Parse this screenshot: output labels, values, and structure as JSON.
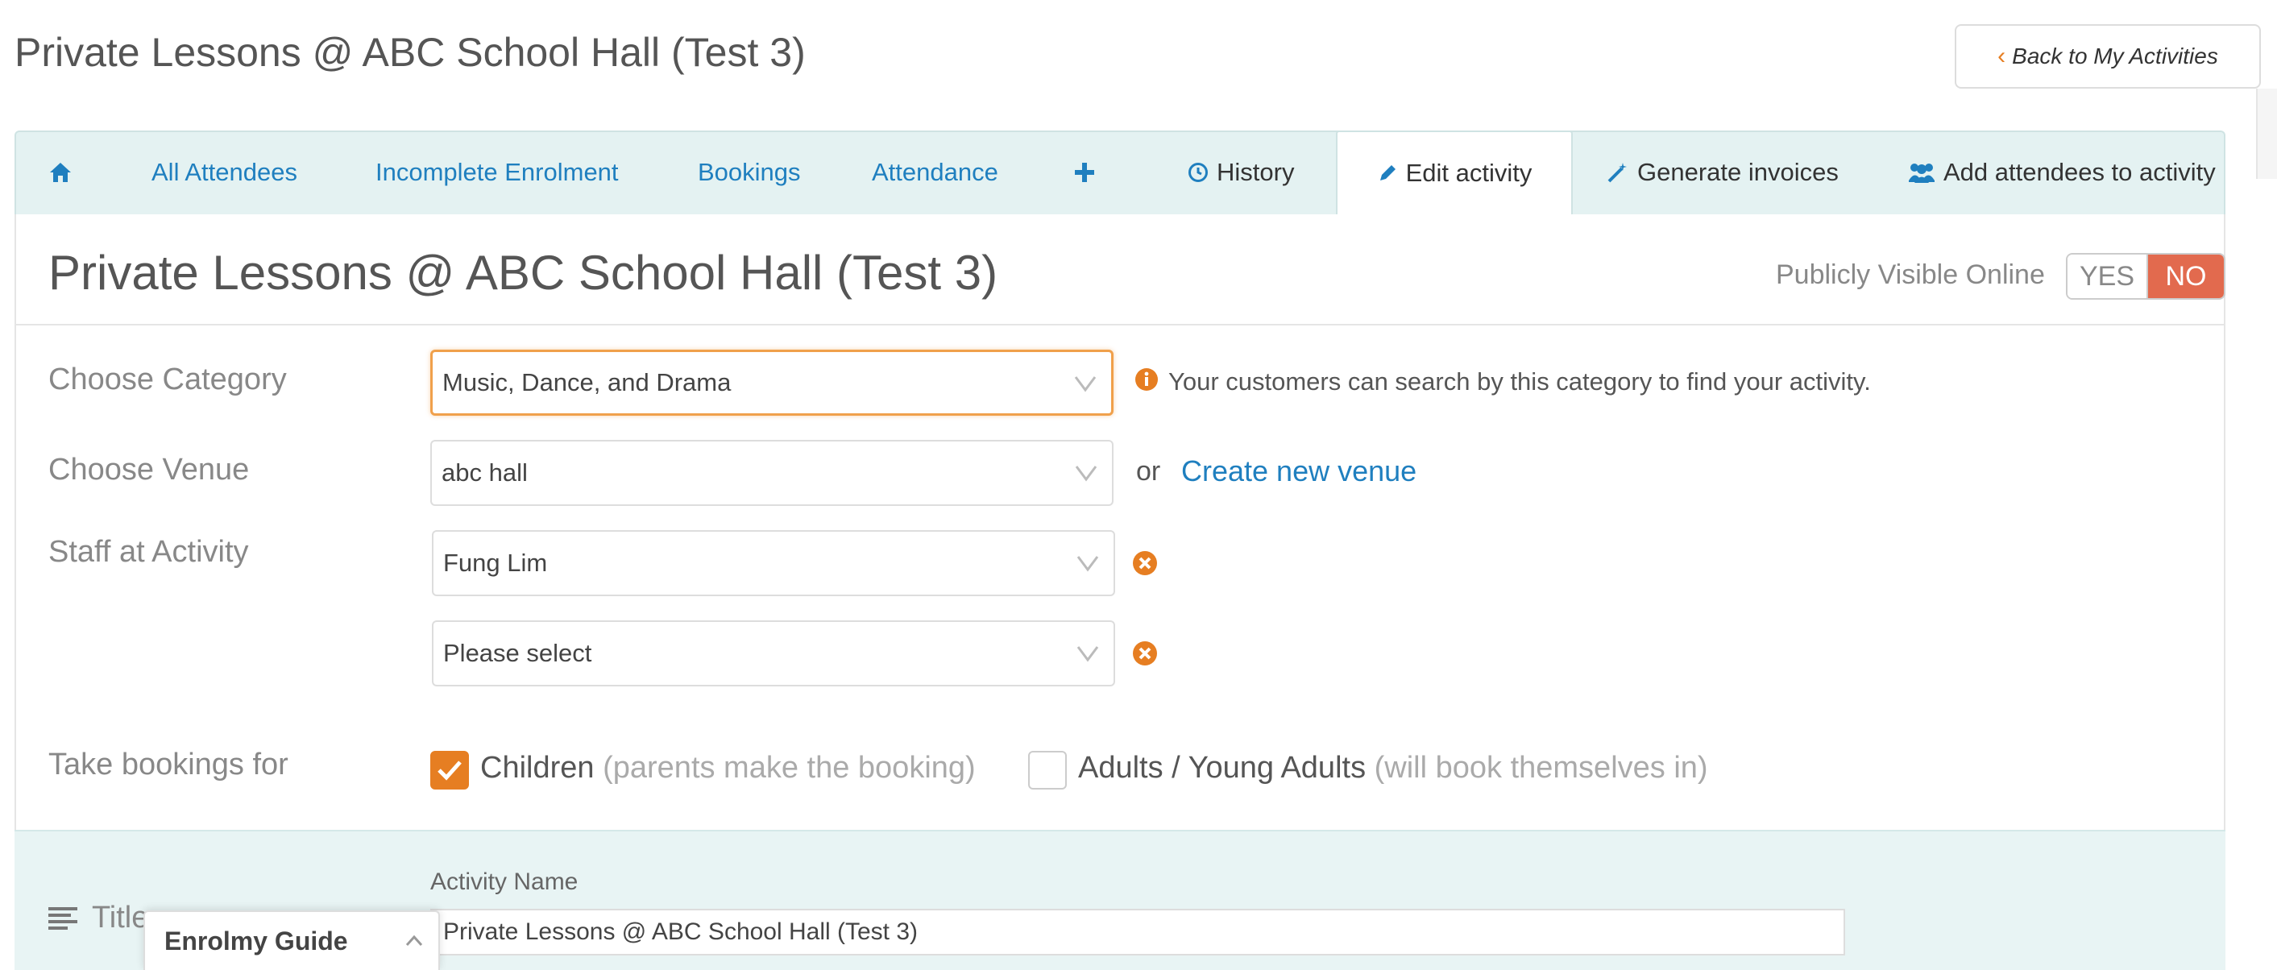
{
  "header": {
    "title": "Private Lessons @ ABC School Hall (Test 3)",
    "back_label": "Back to My Activities"
  },
  "tabs": {
    "home_icon": "home-icon",
    "all_attendees": "All Attendees",
    "incomplete": "Incomplete Enrolment",
    "bookings": "Bookings",
    "attendance": "Attendance",
    "plus_icon": "plus-icon",
    "history": "History",
    "edit": "Edit activity",
    "invoices": "Generate invoices",
    "add_attendees": "Add attendees to activity"
  },
  "activity": {
    "heading": "Private Lessons @ ABC School Hall (Test 3)",
    "visibility_label": "Publicly Visible Online",
    "yes": "YES",
    "no": "NO",
    "selected_visibility": "NO"
  },
  "form": {
    "category_label": "Choose Category",
    "category_value": "Music, Dance, and Drama",
    "category_hint": "Your customers can search by this category to find your activity.",
    "venue_label": "Choose Venue",
    "venue_value": "abc hall",
    "venue_or": "or",
    "create_venue": "Create new venue",
    "staff_label": "Staff at Activity",
    "staff": [
      "Fung Lim",
      "Please select"
    ],
    "bookings_label": "Take bookings for",
    "children_label": "Children",
    "children_sub": "(parents make the booking)",
    "children_checked": true,
    "adults_label": "Adults / Young Adults",
    "adults_sub": "(will book themselves in)",
    "adults_checked": false
  },
  "title_section": {
    "label": "Title",
    "name_label": "Activity Name",
    "name_value": "Private Lessons @ ABC School Hall (Test 3)"
  },
  "guide": {
    "label": "Enrolmy Guide"
  },
  "colors": {
    "accent": "#e67e22",
    "link": "#1f7fbf",
    "no_active": "#e26a4e",
    "tab_bg": "#e4f2f2"
  }
}
